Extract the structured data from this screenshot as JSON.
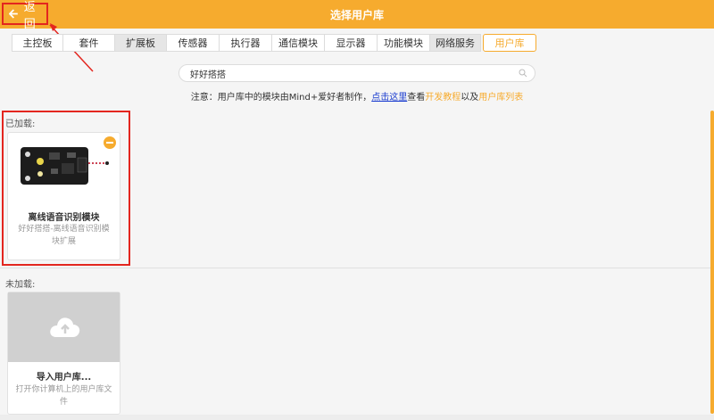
{
  "header": {
    "back_label": "返回",
    "title": "选择用户库"
  },
  "tabs": [
    {
      "label": "主控板"
    },
    {
      "label": "套件"
    },
    {
      "label": "扩展板"
    },
    {
      "label": "传感器"
    },
    {
      "label": "执行器"
    },
    {
      "label": "通信模块"
    },
    {
      "label": "显示器"
    },
    {
      "label": "功能模块"
    },
    {
      "label": "网络服务"
    },
    {
      "label": "用户库"
    }
  ],
  "search": {
    "value": "好好搭搭",
    "icon": "search-icon"
  },
  "notice": {
    "prefix": "注意：用户库中的模块由Mind+爱好者制作，",
    "link": "点击这里",
    "mid1": "查看",
    "dev_tutorial": "开发教程",
    "mid2": "以及",
    "user_lib_list": "用户库列表"
  },
  "loaded": {
    "label": "已加载:",
    "cards": [
      {
        "name": "离线语音识别模块",
        "desc": "好好搭搭-离线语音识别模块扩展"
      }
    ]
  },
  "unloaded": {
    "label": "未加载:",
    "import_card": {
      "name": "导入用户库...",
      "desc": "打开你计算机上的用户库文件",
      "icon": "cloud-upload-icon"
    }
  },
  "colors": {
    "accent": "#f6ab2e",
    "highlight": "#e3261f",
    "link": "#1a3ccf"
  }
}
